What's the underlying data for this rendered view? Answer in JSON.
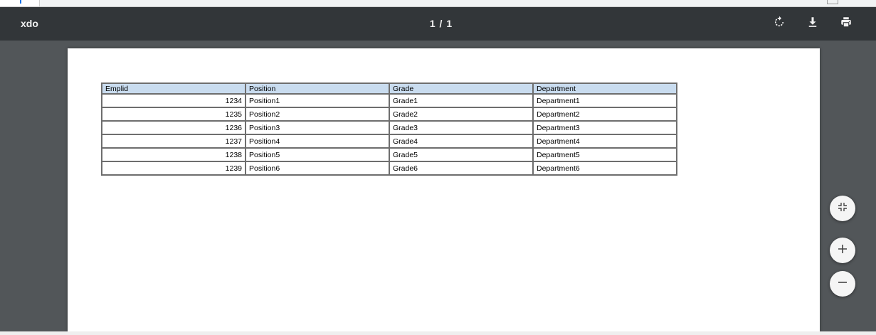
{
  "viewer": {
    "title": "xdo",
    "page_indicator": "1 / 1",
    "actions": {
      "rotate_icon": "rotate-icon",
      "download_icon": "download-icon",
      "print_icon": "print-icon"
    },
    "zoom_controls": {
      "fit_icon": "fit-to-page-icon",
      "zoom_in_icon": "plus-icon",
      "zoom_out_icon": "minus-icon"
    },
    "colors": {
      "toolbar": "#323639",
      "background": "#525659",
      "table_header": "#c9dcef"
    }
  },
  "report_table": {
    "headers": [
      "Emplid",
      "Position",
      "Grade",
      "Department"
    ],
    "rows": [
      [
        "1234",
        "Position1",
        "Grade1",
        "Department1"
      ],
      [
        "1235",
        "Position2",
        "Grade2",
        "Department2"
      ],
      [
        "1236",
        "Position3",
        "Grade3",
        "Department3"
      ],
      [
        "1237",
        "Position4",
        "Grade4",
        "Department4"
      ],
      [
        "1238",
        "Position5",
        "Grade5",
        "Department5"
      ],
      [
        "1239",
        "Position6",
        "Grade6",
        "Department6"
      ]
    ]
  }
}
